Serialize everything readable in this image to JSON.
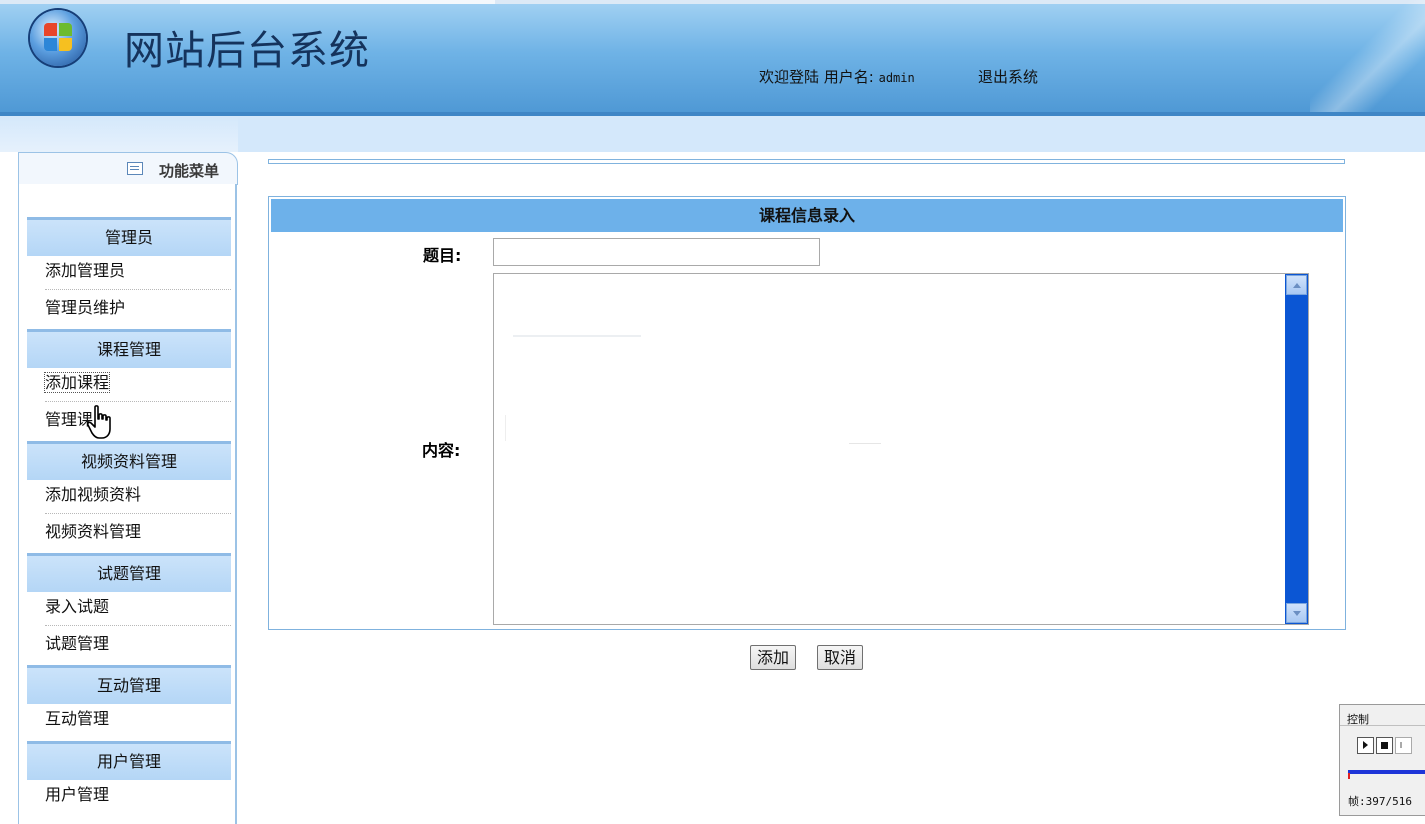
{
  "header": {
    "title": "网站后台系统",
    "welcome_text": "欢迎登陆 用户名:",
    "username": "admin",
    "logout_label": "退出系统"
  },
  "sidebar": {
    "tab_label": "功能菜单",
    "groups": [
      {
        "title": "管理员",
        "items": [
          "添加管理员",
          "管理员维护"
        ]
      },
      {
        "title": "课程管理",
        "items": [
          "添加课程",
          "管理课"
        ]
      },
      {
        "title": "视频资料管理",
        "items": [
          "添加视频资料",
          "视频资料管理"
        ]
      },
      {
        "title": "试题管理",
        "items": [
          "录入试题",
          "试题管理"
        ]
      },
      {
        "title": "互动管理",
        "items": [
          "互动管理"
        ]
      },
      {
        "title": "用户管理",
        "items": [
          "用户管理"
        ]
      }
    ]
  },
  "form": {
    "heading": "课程信息录入",
    "title_label": "题目:",
    "title_value": "",
    "content_label": "内容:",
    "content_value": "",
    "add_button": "添加",
    "cancel_button": "取消"
  },
  "player": {
    "title": "控制",
    "frame_text": "帧:397/516"
  },
  "colors": {
    "header_blue": "#6fb3e6",
    "form_header": "#6db1ea",
    "menu_group": "#b4d6f6",
    "scrollbar": "#0b56d4"
  }
}
